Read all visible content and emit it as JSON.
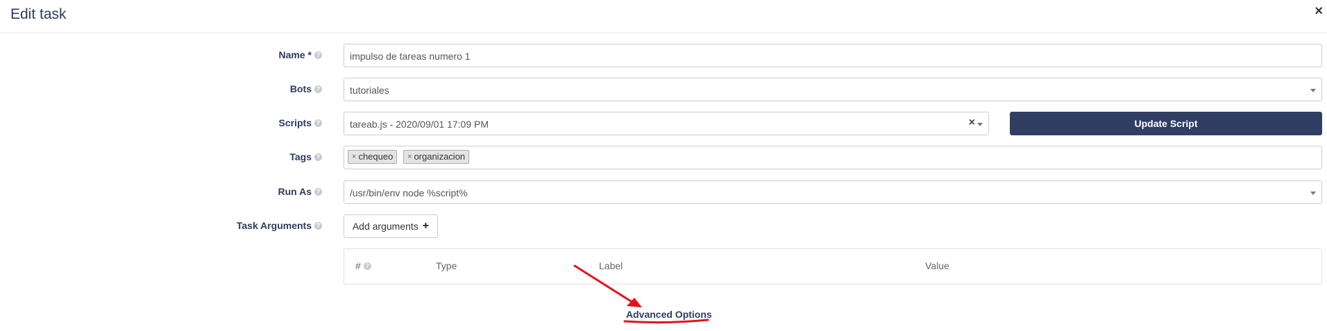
{
  "modal": {
    "title": "Edit task",
    "close_label": "×"
  },
  "fields": {
    "name": {
      "label": "Name *",
      "value": "impulso de tareas numero 1"
    },
    "bots": {
      "label": "Bots",
      "value": "tutoriales"
    },
    "scripts": {
      "label": "Scripts",
      "value": "tareab.js - 2020/09/01 17:09 PM",
      "clear_label": "×",
      "update_button": "Update Script"
    },
    "tags": {
      "label": "Tags",
      "items": [
        "chequeo",
        "organizacion"
      ],
      "remove_label": "×"
    },
    "run_as": {
      "label": "Run As",
      "value": "/usr/bin/env node %script%"
    },
    "task_arguments": {
      "label": "Task Arguments",
      "add_button": "Add arguments",
      "add_icon": "+"
    }
  },
  "help_icon": "?",
  "arguments_table": {
    "columns": [
      "#",
      "Type",
      "Label",
      "Value"
    ]
  },
  "advanced_options": "Advanced Options",
  "annotation_color": "#e8101a"
}
